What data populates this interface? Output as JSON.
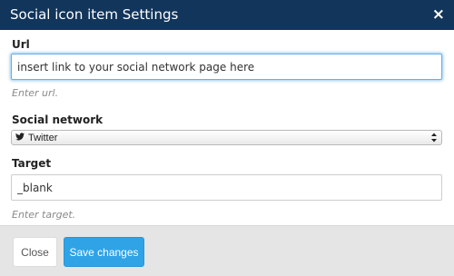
{
  "dialog": {
    "title": "Social icon item Settings",
    "close_symbol": "×"
  },
  "url_field": {
    "label": "Url",
    "value": "insert link to your social network page here",
    "help": "Enter url."
  },
  "social_network": {
    "label": "Social network",
    "icon": "twitter-bird-icon",
    "selected": "Twitter"
  },
  "target_field": {
    "label": "Target",
    "value": "_blank",
    "help": "Enter target."
  },
  "footer": {
    "close_label": "Close",
    "save_label": "Save changes"
  },
  "colors": {
    "header_bg": "#12355b",
    "primary": "#2fa3e6",
    "focus": "#66afe9"
  }
}
